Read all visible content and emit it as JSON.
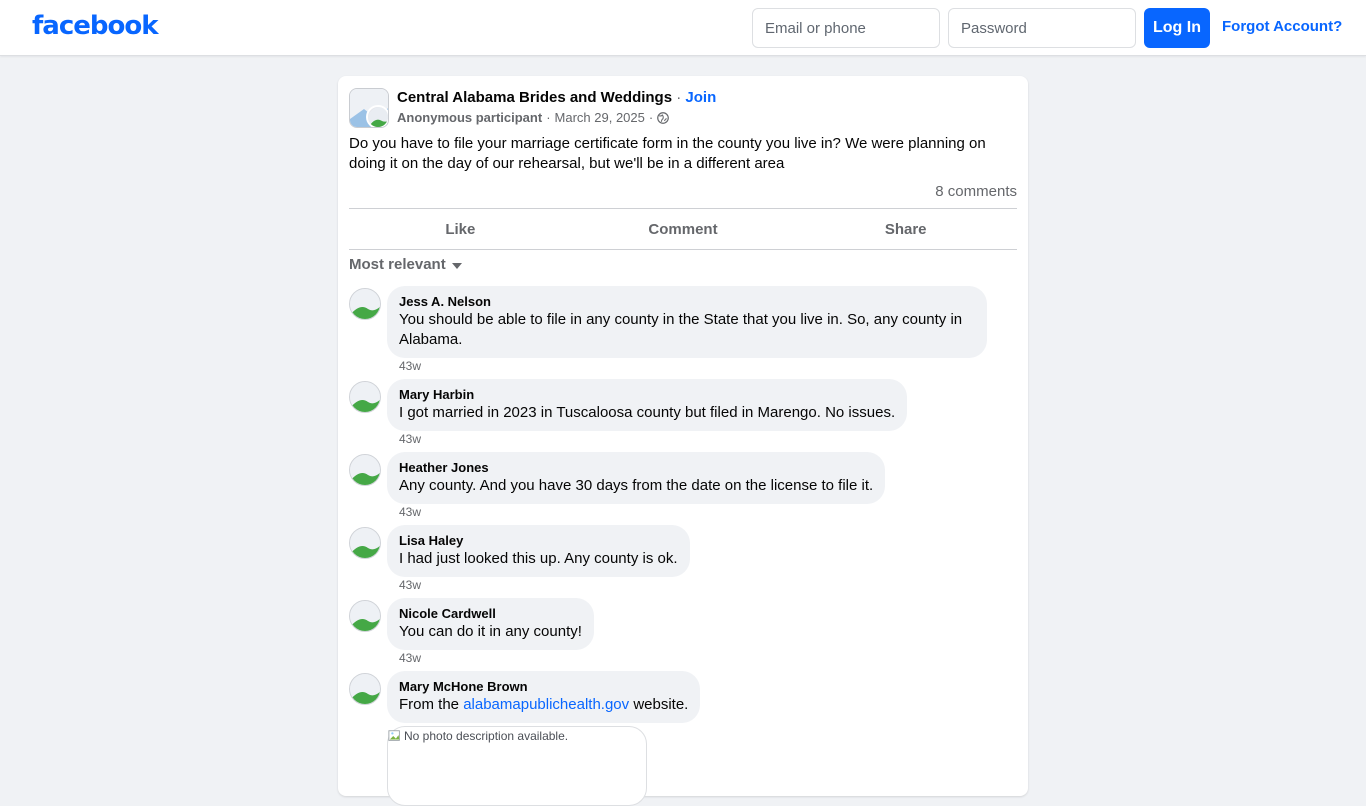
{
  "header": {
    "logo": "facebook",
    "email_placeholder": "Email or phone",
    "password_placeholder": "Password",
    "login_label": "Log In",
    "forgot_label": "Forgot Account?"
  },
  "post": {
    "group_name": "Central Alabama Brides and Weddings",
    "separator": "·",
    "join_label": "Join",
    "author": "Anonymous participant",
    "date": "March 29, 2025",
    "text": "Do you have to file your marriage certificate form in the county you live in? We were planning on doing it on the day of our rehearsal, but we'll be in a different area",
    "comments_count": "8 comments"
  },
  "actions": {
    "like": "Like",
    "comment": "Comment",
    "share": "Share"
  },
  "sort_label": "Most relevant",
  "comments": [
    {
      "name": "Jess A. Nelson",
      "text": "You should be able to file in any county in the State that you live in. So, any county in Alabama.",
      "time": "43w"
    },
    {
      "name": "Mary Harbin",
      "text": "I got married in 2023 in Tuscaloosa county but filed in Marengo. No issues.",
      "time": "43w"
    },
    {
      "name": "Heather Jones",
      "text": "Any county. And you have 30 days from the date on the license to file it.",
      "time": "43w"
    },
    {
      "name": "Lisa Haley",
      "text": "I had just looked this up. Any county is ok.",
      "time": "43w"
    },
    {
      "name": "Nicole Cardwell",
      "text": "You can do it in any county!",
      "time": "43w"
    },
    {
      "name": "Mary McHone Brown",
      "text_before": "From the",
      "link": "alabamapublichealth.gov",
      "text_after": "website."
    }
  ],
  "attachment_alt": "No photo description available.",
  "icons": {
    "globe": "globe-icon",
    "caret": "caret-down-icon",
    "avatar": "avatar-placeholder-icon",
    "broken_image": "broken-image-icon"
  },
  "colors": {
    "brand": "#0866ff",
    "background": "#f0f2f5",
    "bubble": "#f0f2f5",
    "secondary_text": "#65676b"
  }
}
